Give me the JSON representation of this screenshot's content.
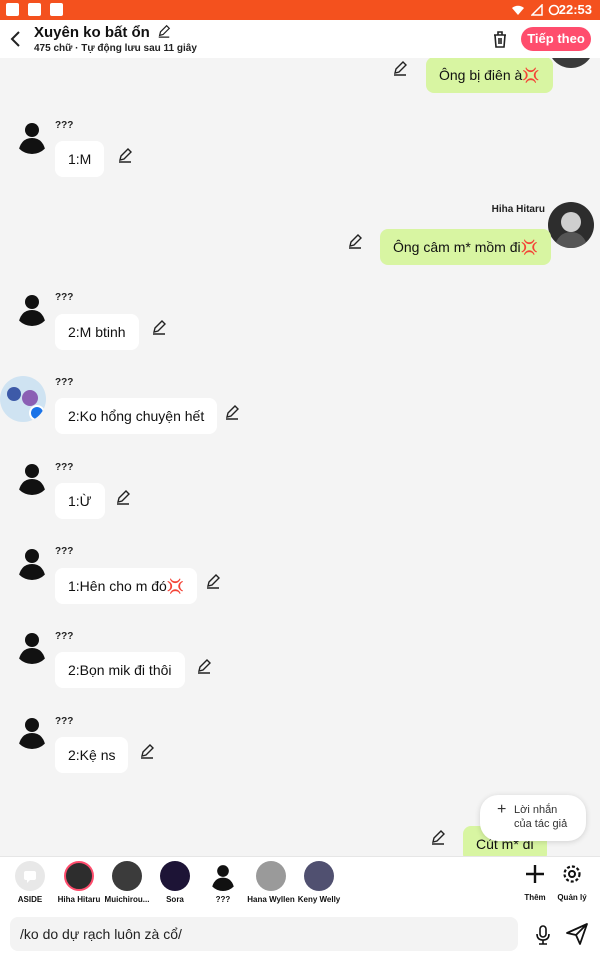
{
  "status_bar": {
    "time": "22:53"
  },
  "header": {
    "title": "Xuyên ko bất ổn",
    "subtitle": "475 chữ · Tự động lưu sau 11 giây",
    "next_label": "Tiếp theo"
  },
  "messages": [
    {
      "side": "right",
      "text": "Ông bị điên à💢"
    },
    {
      "side": "left",
      "name": "???",
      "text": "1:M"
    },
    {
      "side": "right",
      "name": "Hiha Hitaru",
      "text": "Ông câm m* mồm đi💢"
    },
    {
      "side": "left",
      "name": "???",
      "text": "2:M btinh"
    },
    {
      "side": "left",
      "name": "???",
      "text": "2:Ko hổng chuyện hết"
    },
    {
      "side": "left",
      "name": "???",
      "text": "1:Ừ"
    },
    {
      "side": "left",
      "name": "???",
      "text": "1:Hên cho m đó💢"
    },
    {
      "side": "left",
      "name": "???",
      "text": "2:Bọn mik đi thôi"
    },
    {
      "side": "left",
      "name": "???",
      "text": "2:Kệ ns"
    },
    {
      "side": "right",
      "text": "Cút m* đi"
    }
  ],
  "floating_button": {
    "line1": "Lời nhắn",
    "line2": "của tác giả"
  },
  "characters": [
    {
      "label": "ASIDE",
      "icon": "chat-bubble-icon"
    },
    {
      "label": "Hiha Hitaru",
      "icon": "avatar"
    },
    {
      "label": "Muichirou...",
      "icon": "avatar"
    },
    {
      "label": "Sora",
      "icon": "avatar"
    },
    {
      "label": "???",
      "icon": "silhouette"
    },
    {
      "label": "Hana Wyllen",
      "icon": "avatar"
    },
    {
      "label": "Keny Welly",
      "icon": "avatar"
    }
  ],
  "tools": {
    "add_label": "Thêm",
    "manage_label": "Quản lý"
  },
  "input": {
    "value": "/ko do dự rạch luôn zà cổ/"
  },
  "colors": {
    "accent": "#f4511e",
    "next_button": "#ff4d6d",
    "my_bubble": "#d8f5a2"
  }
}
